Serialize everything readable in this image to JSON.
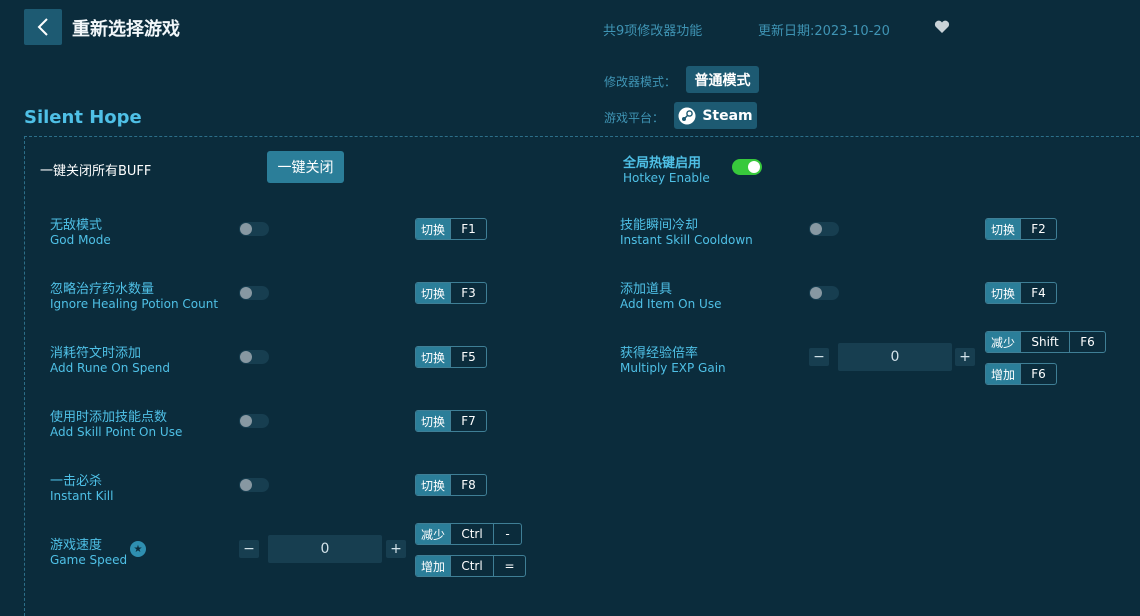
{
  "header": {
    "title": "重新选择游戏",
    "feature_count": "共9项修改器功能",
    "update_date": "更新日期:2023-10-20"
  },
  "mode": {
    "label": "修改器模式：",
    "value": "普通模式"
  },
  "platform": {
    "label": "游戏平台：",
    "value": "Steam"
  },
  "game": {
    "title": "Silent Hope"
  },
  "buff": {
    "label": "一键关闭所有BUFF",
    "button": "一键关闭"
  },
  "hotkey": {
    "cn": "全局热键启用",
    "en": "Hotkey Enable",
    "enabled": true
  },
  "hk_labels": {
    "toggle": "切换",
    "decrease": "减少",
    "increase": "增加"
  },
  "features": [
    {
      "cn": "无敌模式",
      "en": "God Mode",
      "key": "F1"
    },
    {
      "cn": "忽略治疗药水数量",
      "en": "Ignore Healing Potion Count",
      "key": "F3"
    },
    {
      "cn": "消耗符文时添加",
      "en": "Add Rune On Spend",
      "key": "F5"
    },
    {
      "cn": "使用时添加技能点数",
      "en": "Add Skill Point On Use",
      "key": "F7"
    },
    {
      "cn": "一击必杀",
      "en": "Instant Kill",
      "key": "F8"
    },
    {
      "cn": "技能瞬间冷却",
      "en": "Instant Skill Cooldown",
      "key": "F2"
    },
    {
      "cn": "添加道具",
      "en": "Add Item On Use",
      "key": "F4"
    }
  ],
  "game_speed": {
    "cn": "游戏速度",
    "en": "Game Speed",
    "value": "0",
    "minus": "−",
    "plus": "+",
    "dec_keys": [
      "Ctrl",
      "-"
    ],
    "inc_keys": [
      "Ctrl",
      "="
    ]
  },
  "exp_gain": {
    "cn": "获得经验倍率",
    "en": "Multiply EXP Gain",
    "value": "0",
    "minus": "−",
    "plus": "+",
    "dec_keys": [
      "Shift",
      "F6"
    ],
    "inc_keys": [
      "F6"
    ]
  },
  "colors": {
    "background": "#0b2c3c",
    "accent": "#4fc0e6",
    "button": "#1d5a72",
    "toggle_on": "#38c93c"
  }
}
